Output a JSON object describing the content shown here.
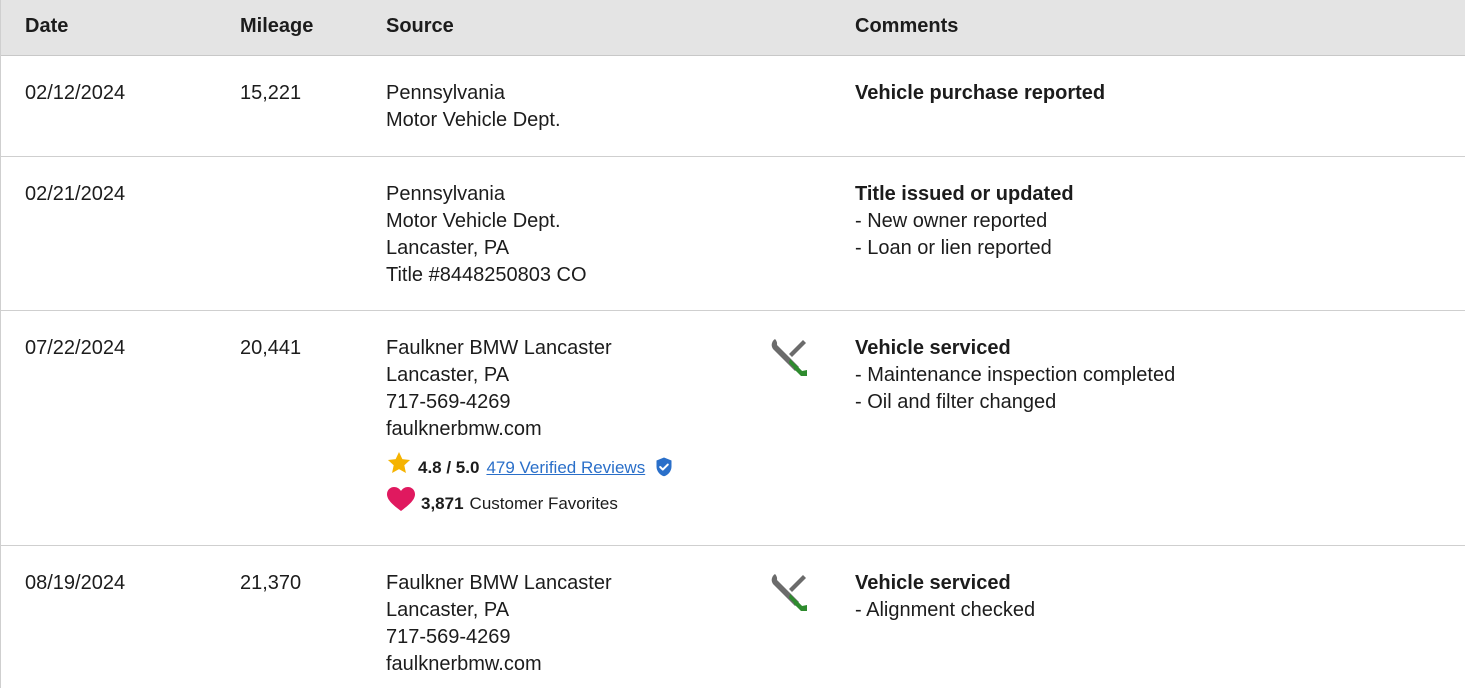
{
  "header": {
    "date": "Date",
    "mileage": "Mileage",
    "source": "Source",
    "comments": "Comments"
  },
  "rows": [
    {
      "date": "02/12/2024",
      "mileage": "15,221",
      "source": [
        "Pennsylvania",
        "Motor Vehicle Dept."
      ],
      "icon": "",
      "comment_title": "Vehicle purchase reported",
      "comment_items": []
    },
    {
      "date": "02/21/2024",
      "mileage": "",
      "source": [
        "Pennsylvania",
        "Motor Vehicle Dept.",
        "Lancaster, PA",
        "Title #8448250803 CO"
      ],
      "icon": "",
      "comment_title": "Title issued or updated",
      "comment_items": [
        "- New owner reported",
        "- Loan or lien reported"
      ]
    },
    {
      "date": "07/22/2024",
      "mileage": "20,441",
      "source": [
        "Faulkner BMW Lancaster",
        "Lancaster, PA",
        "717-569-4269",
        "faulknerbmw.com"
      ],
      "icon": "service-wrench-screwdriver-icon",
      "rating": {
        "score": "4.8 / 5.0",
        "reviews_link": "479 Verified Reviews",
        "favorites_count": "3,871",
        "favorites_label": "Customer Favorites"
      },
      "comment_title": "Vehicle serviced",
      "comment_items": [
        "- Maintenance inspection completed",
        "- Oil and filter changed"
      ]
    },
    {
      "date": "08/19/2024",
      "mileage": "21,370",
      "source": [
        "Faulkner BMW Lancaster",
        "Lancaster, PA",
        "717-569-4269",
        "faulknerbmw.com"
      ],
      "icon": "service-wrench-screwdriver-icon",
      "comment_title": "Vehicle serviced",
      "comment_items": [
        "- Alignment checked"
      ]
    }
  ],
  "colors": {
    "header_bg": "#e4e4e4",
    "link": "#2a6fc9",
    "star": "#f5b301",
    "heart": "#e0195f",
    "shield": "#2a6fc9",
    "tool_gray": "#6b6b6b",
    "tool_green": "#2e8b2e"
  }
}
